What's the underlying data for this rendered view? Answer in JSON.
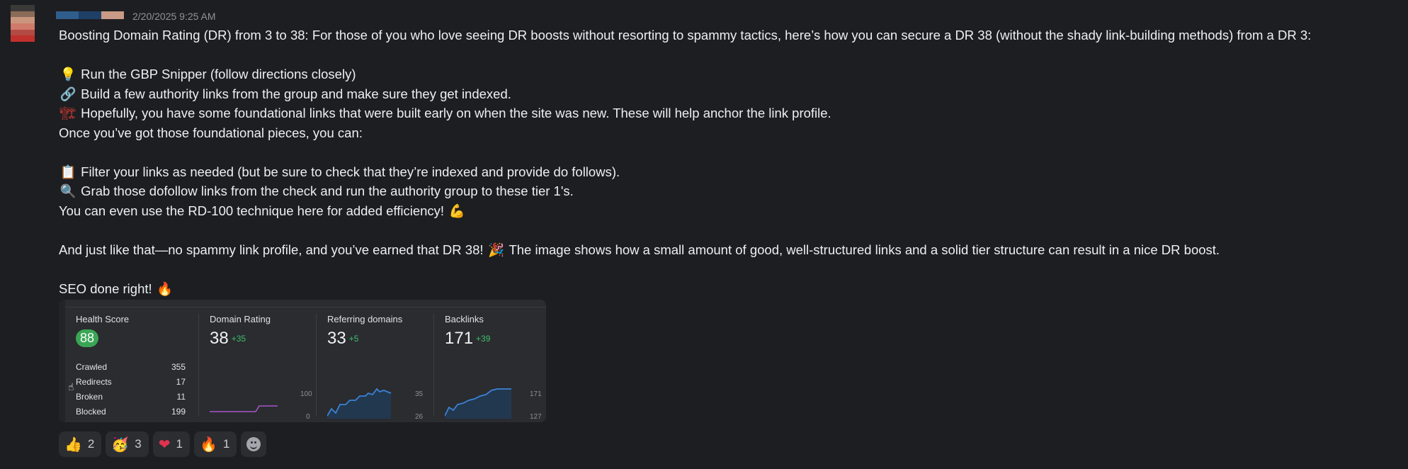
{
  "header": {
    "timestamp": "2/20/2025 9:25 AM",
    "avatar_colors": [
      "#3b3a39",
      "#8a6a58",
      "#c9957d",
      "#cf7a6a",
      "#b44a44",
      "#c0302c"
    ],
    "name_colors": [
      "#2f5d8c",
      "#1e3f66",
      "#c99a86"
    ]
  },
  "message": {
    "intro": "Boosting Domain Rating (DR) from 3 to 38: For those of you who love seeing DR boosts without resorting to spammy tactics, here’s how you can secure a DR 38 (without the shady link-building methods) from a DR 3:",
    "step1": "Run the GBP Snipper (follow directions closely)",
    "step2": "Build a few authority links from the group and make sure they get indexed.",
    "step3": "Hopefully, you have some foundational links that were built early on when the site was new. These will help anchor the link profile.",
    "transition": "Once you’ve got those foundational pieces, you can:",
    "step4": "Filter your links as needed (but be sure to check that they’re indexed and provide do follows).",
    "step5": "Grab those dofollow links from the check and run the authority group to these tier 1's.",
    "rd100": "You can even use the RD-100 technique here for added efficiency!",
    "result_a": "And just like that—no spammy link profile, and you’ve earned that DR 38!",
    "result_b": "The image shows how a small amount of good, well-structured links and a solid tier structure can result in a nice DR boost.",
    "closing": "SEO done right!"
  },
  "icons": {
    "bulb": "lightbulb-icon",
    "link": "link-icon",
    "crane": "construction-crane-icon",
    "clipboard": "clipboard-icon",
    "magnifier": "magnifier-icon",
    "muscle": "flexed-biceps-icon",
    "party": "party-popper-icon",
    "fire": "fire-icon"
  },
  "embed": {
    "health": {
      "title": "Health Score",
      "score": "88",
      "rows": [
        {
          "label": "Crawled",
          "value": "355"
        },
        {
          "label": "Redirects",
          "value": "17"
        },
        {
          "label": "Broken",
          "value": "11"
        },
        {
          "label": "Blocked",
          "value": "199"
        }
      ]
    },
    "dr": {
      "title": "Domain Rating",
      "value": "38",
      "delta": "+35",
      "axis_top": "100",
      "axis_bottom": "0"
    },
    "rd": {
      "title": "Referring domains",
      "value": "33",
      "delta": "+5",
      "axis_top": "35",
      "axis_bottom": "26"
    },
    "bl": {
      "title": "Backlinks",
      "value": "171",
      "delta": "+39",
      "axis_top": "171",
      "axis_bottom": "127"
    }
  },
  "reactions": [
    {
      "emoji": "👍",
      "count": "2",
      "name": "thumbs-up"
    },
    {
      "emoji": "🥳",
      "count": "3",
      "name": "party-face"
    },
    {
      "emoji": "❤",
      "count": "1",
      "name": "heart"
    },
    {
      "emoji": "🔥",
      "count": "1",
      "name": "fire"
    }
  ],
  "colors": {
    "accent_green": "#3fbf6a",
    "badge_green": "#3aa655",
    "dr_line": "#a855c7",
    "spark_blue": "#3b82d6"
  }
}
